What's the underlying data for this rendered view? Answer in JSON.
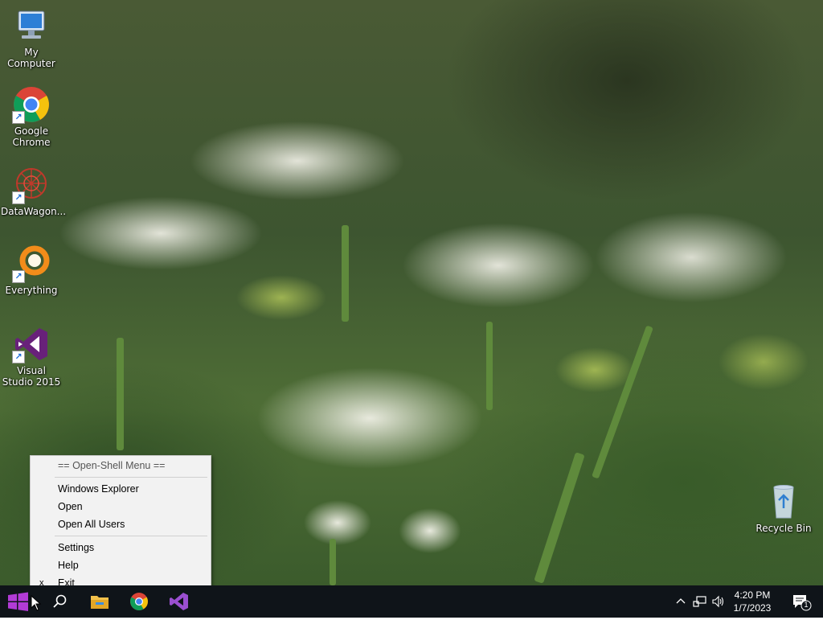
{
  "desktop": {
    "icons": [
      {
        "label": "My Computer",
        "icon": "computer-icon"
      },
      {
        "label": "Google Chrome",
        "icon": "chrome-icon"
      },
      {
        "label": "DataWagon...",
        "icon": "datawagon-icon"
      },
      {
        "label": "Everything",
        "icon": "everything-icon"
      },
      {
        "label": "Visual Studio 2015",
        "icon": "visual-studio-icon"
      },
      {
        "label": "Recycle Bin",
        "icon": "recycle-bin-icon"
      }
    ]
  },
  "context_menu": {
    "header": "== Open-Shell Menu ==",
    "items": [
      {
        "label": "Windows Explorer"
      },
      {
        "label": "Open"
      },
      {
        "label": "Open All Users"
      },
      {
        "label": "Settings"
      },
      {
        "label": "Help"
      },
      {
        "label": "Exit",
        "mark": "x"
      }
    ]
  },
  "taskbar": {
    "start": "start-button",
    "pinned": [
      "search-icon",
      "file-explorer-icon",
      "chrome-icon",
      "visual-studio-icon"
    ],
    "tray": {
      "time": "4:20 PM",
      "date": "1/7/2023",
      "notifications_count": "1"
    },
    "colors": {
      "start": "#b23bd6",
      "background": "#0f1419"
    }
  }
}
